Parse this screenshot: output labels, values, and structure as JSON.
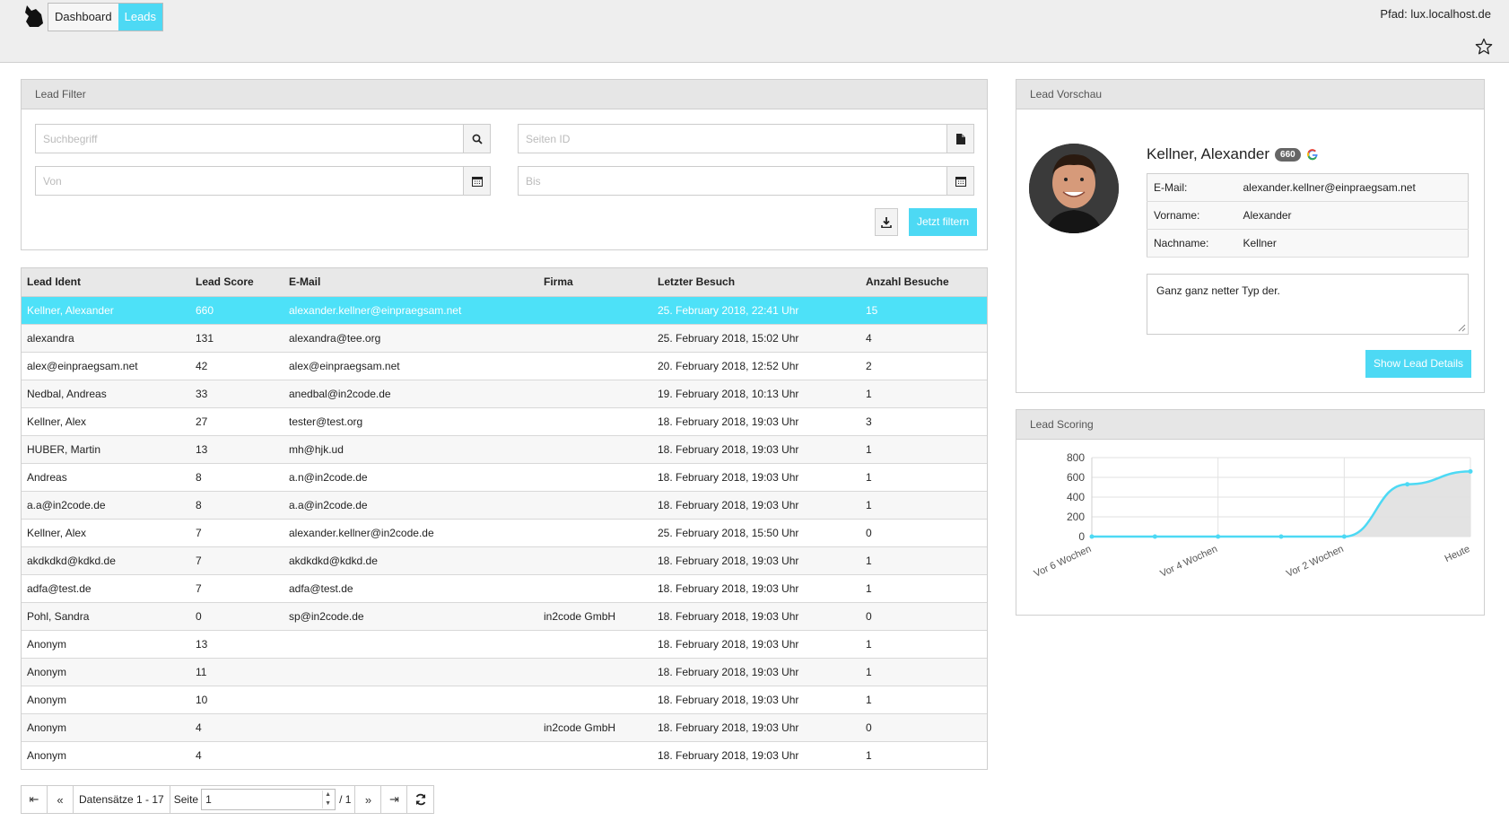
{
  "header": {
    "nav": [
      {
        "label": "Dashboard",
        "active": false
      },
      {
        "label": "Leads",
        "active": true
      }
    ],
    "path_text": "Pfad: lux.localhost.de",
    "accent_color": "#4dd9f4"
  },
  "filter": {
    "title": "Lead Filter",
    "search_placeholder": "Suchbegriff",
    "page_id_placeholder": "Seiten ID",
    "from_placeholder": "Von",
    "to_placeholder": "Bis",
    "submit_label": "Jetzt filtern"
  },
  "table": {
    "columns": [
      "Lead Ident",
      "Lead Score",
      "E-Mail",
      "Firma",
      "Letzter Besuch",
      "Anzahl Besuche"
    ],
    "rows": [
      {
        "ident": "Kellner, Alexander",
        "score": "660",
        "email": "alexander.kellner@einpraegsam.net",
        "company": "",
        "last_visit": "25. February 2018, 22:41 Uhr",
        "visits": "15",
        "selected": true
      },
      {
        "ident": "alexandra",
        "score": "131",
        "email": "alexandra@tee.org",
        "company": "",
        "last_visit": "25. February 2018, 15:02 Uhr",
        "visits": "4"
      },
      {
        "ident": "alex@einpraegsam.net",
        "score": "42",
        "email": "alex@einpraegsam.net",
        "company": "",
        "last_visit": "20. February 2018, 12:52 Uhr",
        "visits": "2"
      },
      {
        "ident": "Nedbal, Andreas",
        "score": "33",
        "email": "anedbal@in2code.de",
        "company": "",
        "last_visit": "19. February 2018, 10:13 Uhr",
        "visits": "1"
      },
      {
        "ident": "Kellner, Alex",
        "score": "27",
        "email": "tester@test.org",
        "company": "",
        "last_visit": "18. February 2018, 19:03 Uhr",
        "visits": "3"
      },
      {
        "ident": "HUBER, Martin",
        "score": "13",
        "email": "mh@hjk.ud",
        "company": "",
        "last_visit": "18. February 2018, 19:03 Uhr",
        "visits": "1"
      },
      {
        "ident": "Andreas",
        "score": "8",
        "email": "a.n@in2code.de",
        "company": "",
        "last_visit": "18. February 2018, 19:03 Uhr",
        "visits": "1"
      },
      {
        "ident": "a.a@in2code.de",
        "score": "8",
        "email": "a.a@in2code.de",
        "company": "",
        "last_visit": "18. February 2018, 19:03 Uhr",
        "visits": "1"
      },
      {
        "ident": "Kellner, Alex",
        "score": "7",
        "email": "alexander.kellner@in2code.de",
        "company": "",
        "last_visit": "25. February 2018, 15:50 Uhr",
        "visits": "0"
      },
      {
        "ident": "akdkdkd@kdkd.de",
        "score": "7",
        "email": "akdkdkd@kdkd.de",
        "company": "",
        "last_visit": "18. February 2018, 19:03 Uhr",
        "visits": "1"
      },
      {
        "ident": "adfa@test.de",
        "score": "7",
        "email": "adfa@test.de",
        "company": "",
        "last_visit": "18. February 2018, 19:03 Uhr",
        "visits": "1"
      },
      {
        "ident": "Pohl, Sandra",
        "score": "0",
        "email": "sp@in2code.de",
        "company": "in2code GmbH",
        "last_visit": "18. February 2018, 19:03 Uhr",
        "visits": "0"
      },
      {
        "ident": "Anonym",
        "score": "13",
        "email": "",
        "company": "",
        "last_visit": "18. February 2018, 19:03 Uhr",
        "visits": "1"
      },
      {
        "ident": "Anonym",
        "score": "11",
        "email": "",
        "company": "",
        "last_visit": "18. February 2018, 19:03 Uhr",
        "visits": "1"
      },
      {
        "ident": "Anonym",
        "score": "10",
        "email": "",
        "company": "",
        "last_visit": "18. February 2018, 19:03 Uhr",
        "visits": "1"
      },
      {
        "ident": "Anonym",
        "score": "4",
        "email": "",
        "company": "in2code GmbH",
        "last_visit": "18. February 2018, 19:03 Uhr",
        "visits": "0"
      },
      {
        "ident": "Anonym",
        "score": "4",
        "email": "",
        "company": "",
        "last_visit": "18. February 2018, 19:03 Uhr",
        "visits": "1"
      }
    ]
  },
  "pagination": {
    "records_text": "Datensätze 1 - 17",
    "page_label": "Seite",
    "page_value": "1",
    "total_pages_text": "/ 1"
  },
  "preview": {
    "title": "Lead Vorschau",
    "name": "Kellner, Alexander",
    "score_badge": "660",
    "fields": [
      {
        "label": "E-Mail:",
        "value": "alexander.kellner@einpraegsam.net"
      },
      {
        "label": "Vorname:",
        "value": "Alexander"
      },
      {
        "label": "Nachname:",
        "value": "Kellner"
      }
    ],
    "note": "Ganz ganz netter Typ der.",
    "details_button": "Show Lead Details"
  },
  "scoring": {
    "title": "Lead Scoring"
  },
  "chart_data": {
    "type": "line",
    "categories": [
      "Vor 6 Wochen",
      "",
      "Vor 4 Wochen",
      "",
      "Vor 2 Wochen",
      "",
      "Heute"
    ],
    "values": [
      0,
      0,
      0,
      0,
      0,
      530,
      660
    ],
    "ylim": [
      0,
      800
    ],
    "yticks": [
      "800",
      "600",
      "400",
      "200",
      "0"
    ],
    "grid": true,
    "line_color": "#4dd9f4",
    "fill_color": "#e0e0e0"
  }
}
